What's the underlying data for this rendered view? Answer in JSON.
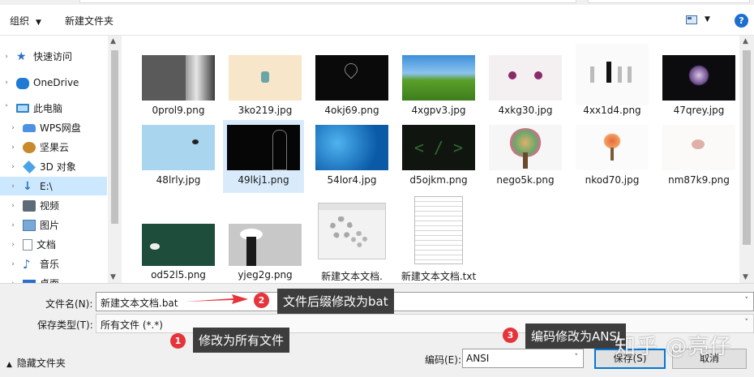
{
  "toolbar": {
    "organize": "组织",
    "new_folder": "新建文件夹",
    "help": "?"
  },
  "nav": {
    "items": [
      {
        "label": "快速访问",
        "icon": "star-icon"
      },
      {
        "label": "OneDrive",
        "icon": "cloud-icon"
      },
      {
        "label": "此电脑",
        "icon": "computer-icon"
      },
      {
        "label": "WPS网盘",
        "icon": "wps-cloud-icon"
      },
      {
        "label": "坚果云",
        "icon": "nut-cloud-icon"
      },
      {
        "label": "3D 对象",
        "icon": "3d-objects-icon"
      },
      {
        "label": "E:\\",
        "icon": "drive-e-icon"
      },
      {
        "label": "视频",
        "icon": "video-icon"
      },
      {
        "label": "图片",
        "icon": "pictures-icon"
      },
      {
        "label": "文档",
        "icon": "documents-icon"
      },
      {
        "label": "音乐",
        "icon": "music-icon"
      },
      {
        "label": "桌面",
        "icon": "desktop-icon"
      }
    ]
  },
  "files": [
    {
      "name": "0prol9.png"
    },
    {
      "name": "3ko219.jpg"
    },
    {
      "name": "4okj69.png"
    },
    {
      "name": "4xgpv3.jpg"
    },
    {
      "name": "4xkg30.jpg"
    },
    {
      "name": "4xx1d4.png"
    },
    {
      "name": "47qrey.jpg"
    },
    {
      "name": "48lrly.jpg"
    },
    {
      "name": "49lkj1.png"
    },
    {
      "name": "54lor4.jpg"
    },
    {
      "name": "d5ojkm.png"
    },
    {
      "name": "nego5k.png"
    },
    {
      "name": "nkod70.jpg"
    },
    {
      "name": "nm87k9.png"
    },
    {
      "name": "od52l5.png"
    },
    {
      "name": "yjeg2g.png"
    },
    {
      "name": "新建文本文档."
    },
    {
      "name": "新建文本文档.txt"
    }
  ],
  "form": {
    "filename_label": "文件名(N):",
    "filename_value": "新建文本文档.bat",
    "filetype_label": "保存类型(T):",
    "filetype_value": "所有文件  (*.*)",
    "hide_folders": "隐藏文件夹",
    "encoding_label": "编码(E):",
    "encoding_value": "ANSI",
    "save": "保存(S)",
    "cancel": "取消"
  },
  "annotations": {
    "c1": {
      "num": "1",
      "text": "修改为所有文件"
    },
    "c2": {
      "num": "2",
      "text": "文件后缀修改为bat"
    },
    "c3": {
      "num": "3",
      "text": "编码修改为ANSI"
    }
  },
  "watermark": "知乎 @亮仔"
}
